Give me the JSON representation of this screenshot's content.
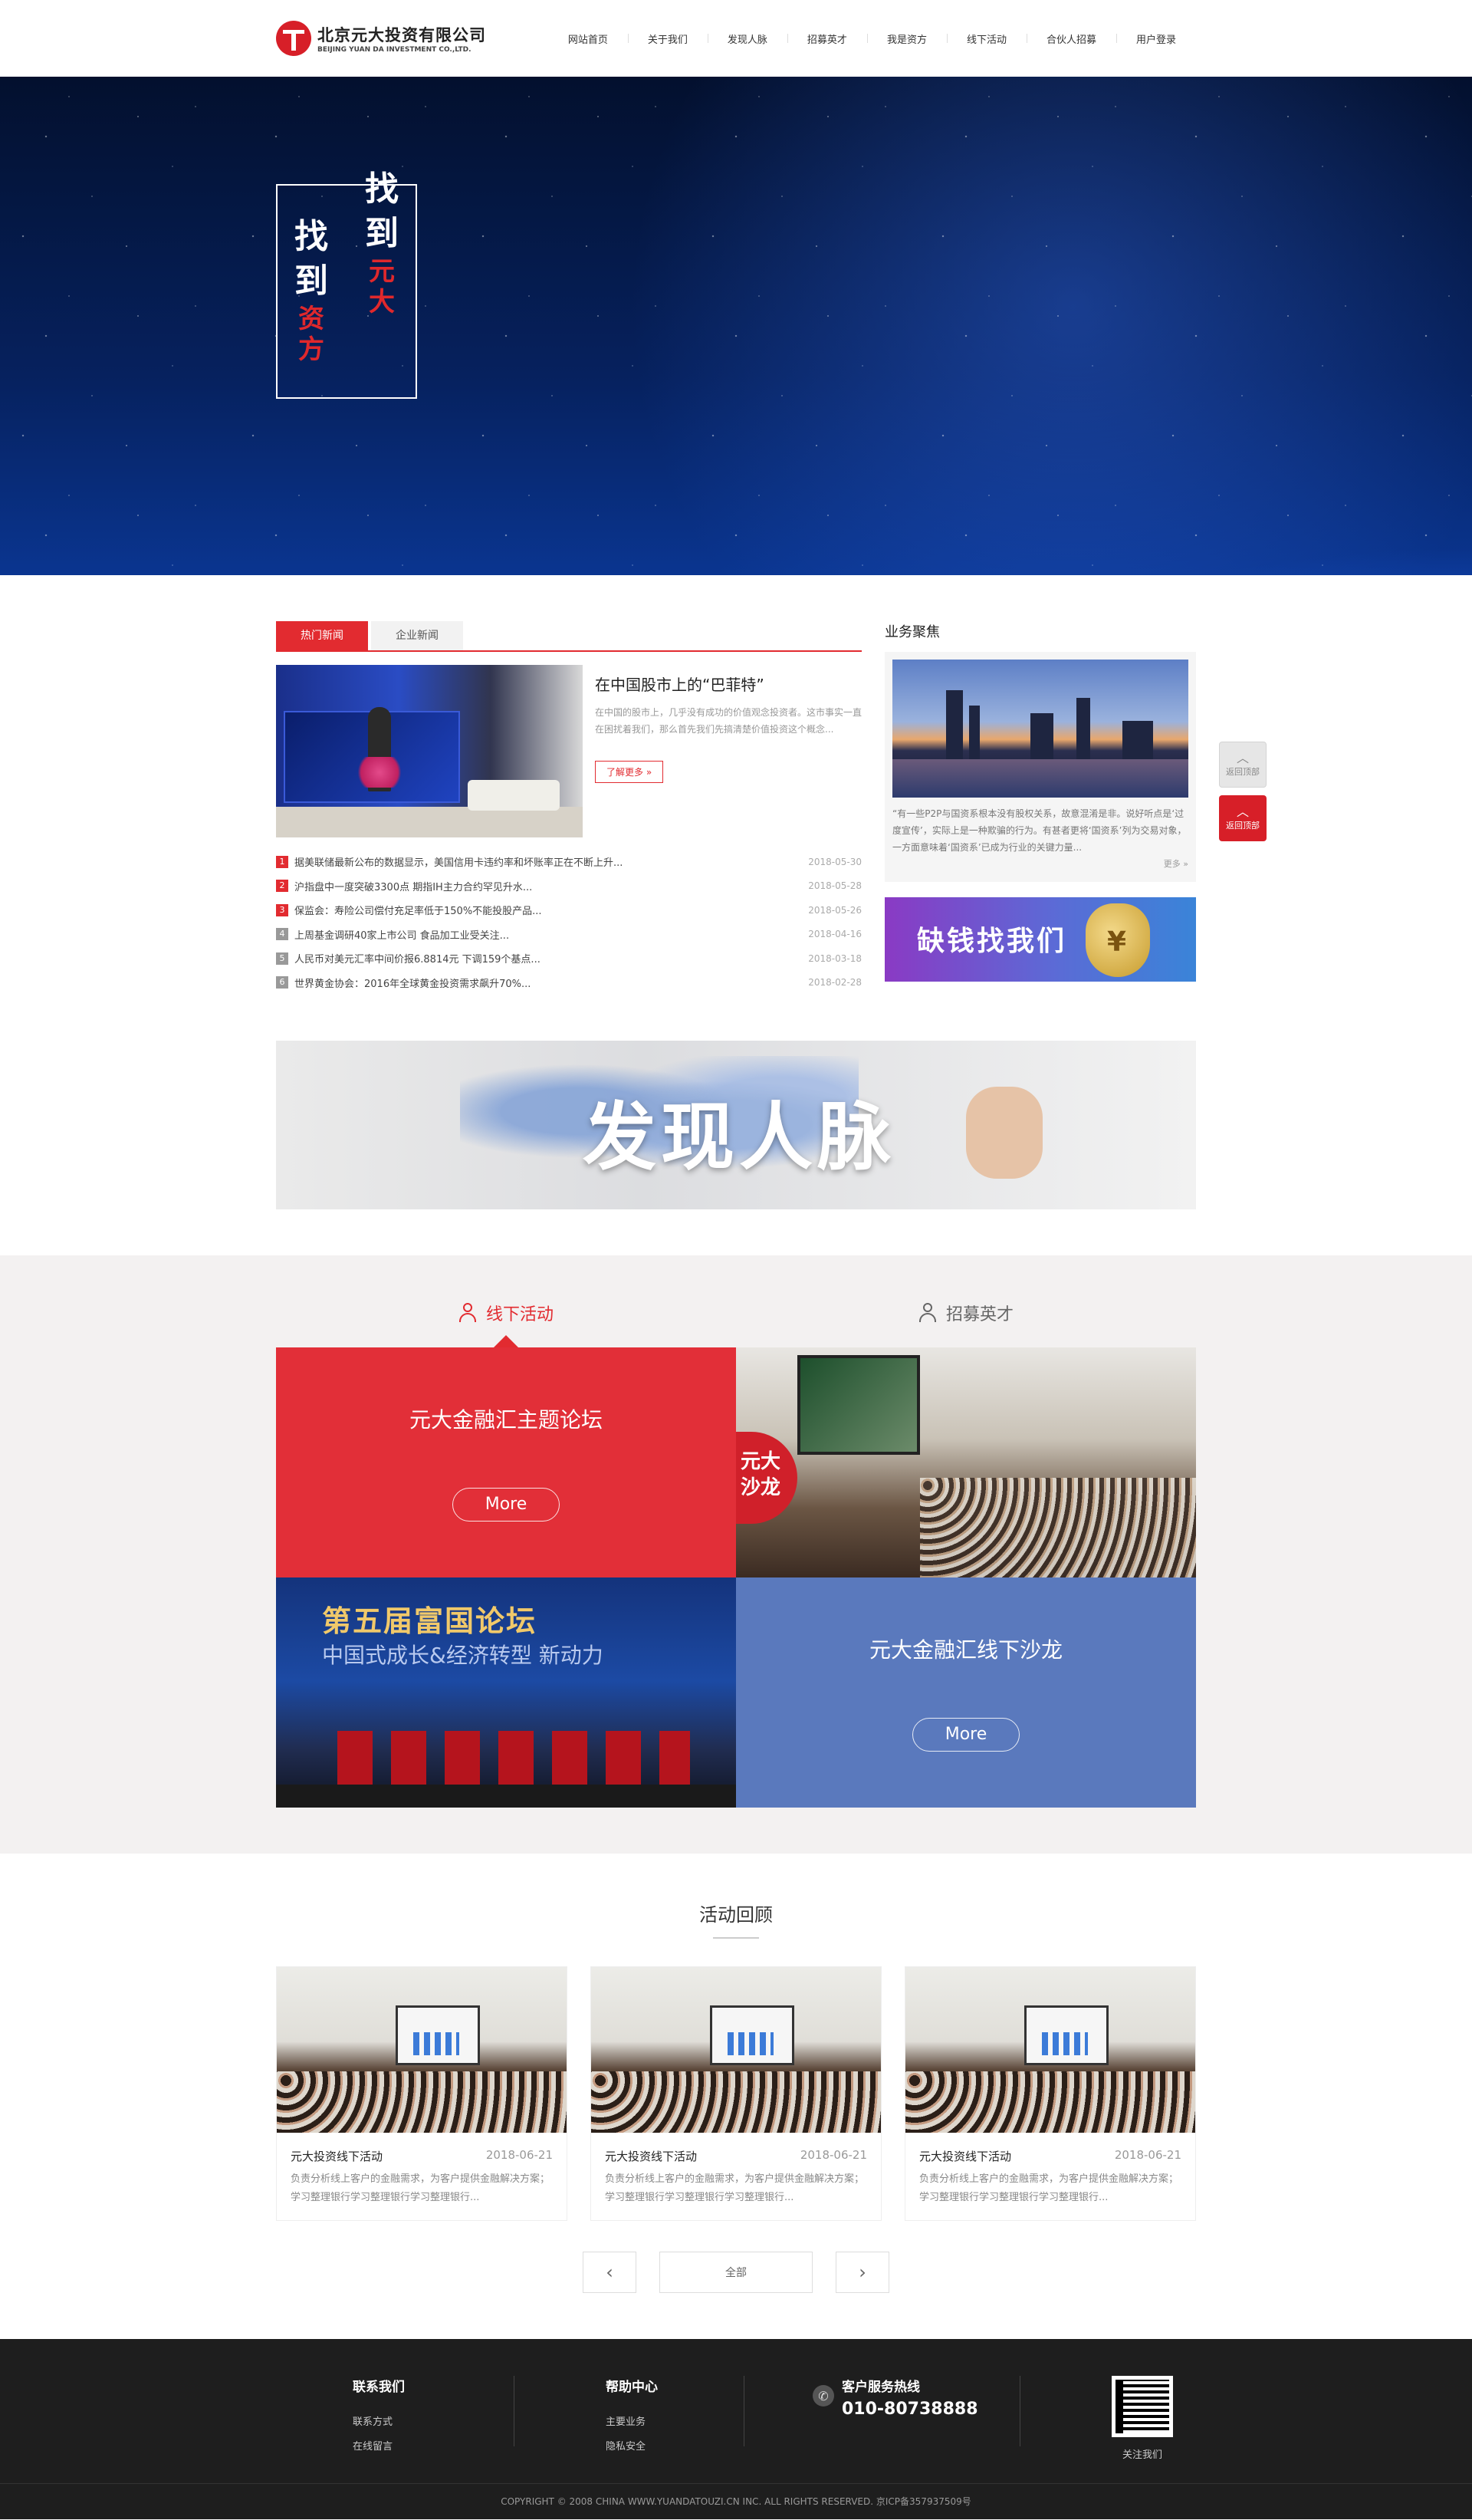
{
  "header": {
    "logo_cn": "北京元大投资有限公司",
    "logo_en": "BEIJING YUAN DA INVESTMENT CO.,LTD.",
    "nav": [
      "网站首页",
      "关于我们",
      "发现人脉",
      "招募英才",
      "我是资方",
      "线下活动",
      "合伙人招募",
      "用户登录"
    ]
  },
  "banner": {
    "slogan_col1_top": "找到",
    "slogan_col1_bottom": "元大",
    "slogan_col2_top": "找到",
    "slogan_col2_bottom": "资方"
  },
  "news": {
    "tabs": [
      "热门新闻",
      "企业新闻"
    ],
    "headline_title": "在中国股市上的“巴菲特”",
    "headline_text": "在中国的股市上，几乎没有成功的价值观念投资者。这市事实一直在困扰着我们，那么首先我们先搞清楚价值投资这个概念...",
    "headline_more": "了解更多 »",
    "items": [
      {
        "num": "1",
        "title": "据美联储最新公布的数据显示，美国信用卡违约率和坏账率正在不断上升...",
        "date": "2018-05-30"
      },
      {
        "num": "2",
        "title": "沪指盘中一度突破3300点 期指IH主力合约罕见升水...",
        "date": "2018-05-28"
      },
      {
        "num": "3",
        "title": "保监会：寿险公司偿付充足率低于150%不能投股产品...",
        "date": "2018-05-26"
      },
      {
        "num": "4",
        "title": "上周基金调研40家上市公司 食品加工业受关注...",
        "date": "2018-04-16"
      },
      {
        "num": "5",
        "title": "人民币对美元汇率中间价报6.8814元 下调159个基点...",
        "date": "2018-03-18"
      },
      {
        "num": "6",
        "title": "世界黄金协会：2016年全球黄金投资需求飙升70%...",
        "date": "2018-02-28"
      }
    ]
  },
  "focus": {
    "title": "业务聚焦",
    "text": "“有一些P2P与国资系根本没有股权关系，故意混淆是非。说好听点是‘过度宣传’，实际上是一种欺骗的行为。有甚者更将‘国资系’列为交易对象，一方面意味着‘国资系’已成为行业的关键力量...",
    "more": "更多 »",
    "ad_text": "缺钱找我们",
    "ad_bag_symbol": "¥"
  },
  "people_banner": {
    "title": "发现人脉"
  },
  "activities": {
    "tabs": [
      "线下活动",
      "招募英才"
    ],
    "cells": [
      {
        "title": "元大金融汇主题论坛",
        "button": "More"
      },
      {
        "title": "元大金融汇线下沙龙",
        "button": "More"
      }
    ],
    "salon_sign": "元大沙龙",
    "forum_line1": "第五届富国论坛",
    "forum_line2": "中国式成长&经济转型 新动力"
  },
  "review": {
    "title": "活动回顾",
    "cards": [
      {
        "title": "元大投资线下活动",
        "date": "2018-06-21",
        "desc": "负责分析线上客户的金融需求，为客户提供金融解决方案；学习整理银行学习整理银行学习整理银行..."
      },
      {
        "title": "元大投资线下活动",
        "date": "2018-06-21",
        "desc": "负责分析线上客户的金融需求，为客户提供金融解决方案；学习整理银行学习整理银行学习整理银行..."
      },
      {
        "title": "元大投资线下活动",
        "date": "2018-06-21",
        "desc": "负责分析线上客户的金融需求，为客户提供金融解决方案；学习整理银行学习整理银行学习整理银行..."
      }
    ],
    "pager_prev": "‹",
    "pager_all": "全部",
    "pager_next": "›"
  },
  "side": {
    "top_label": "返回顶部",
    "red_label": "返回顶部",
    "chev": "︿"
  },
  "footer": {
    "contact_title": "联系我们",
    "contact_links": [
      "联系方式",
      "在线留言"
    ],
    "help_title": "帮助中心",
    "help_links": [
      "主要业务",
      "隐私安全"
    ],
    "hotline_title": "客户服务热线",
    "hotline_number": "010-80738888",
    "phone_icon": "✆",
    "qr_label": "关注我们",
    "copyright": "COPYRIGHT © 2008 CHINA WWW.YUANDATOUZI.CN INC. ALL RIGHTS RESERVED. 京ICP备357937509号"
  }
}
